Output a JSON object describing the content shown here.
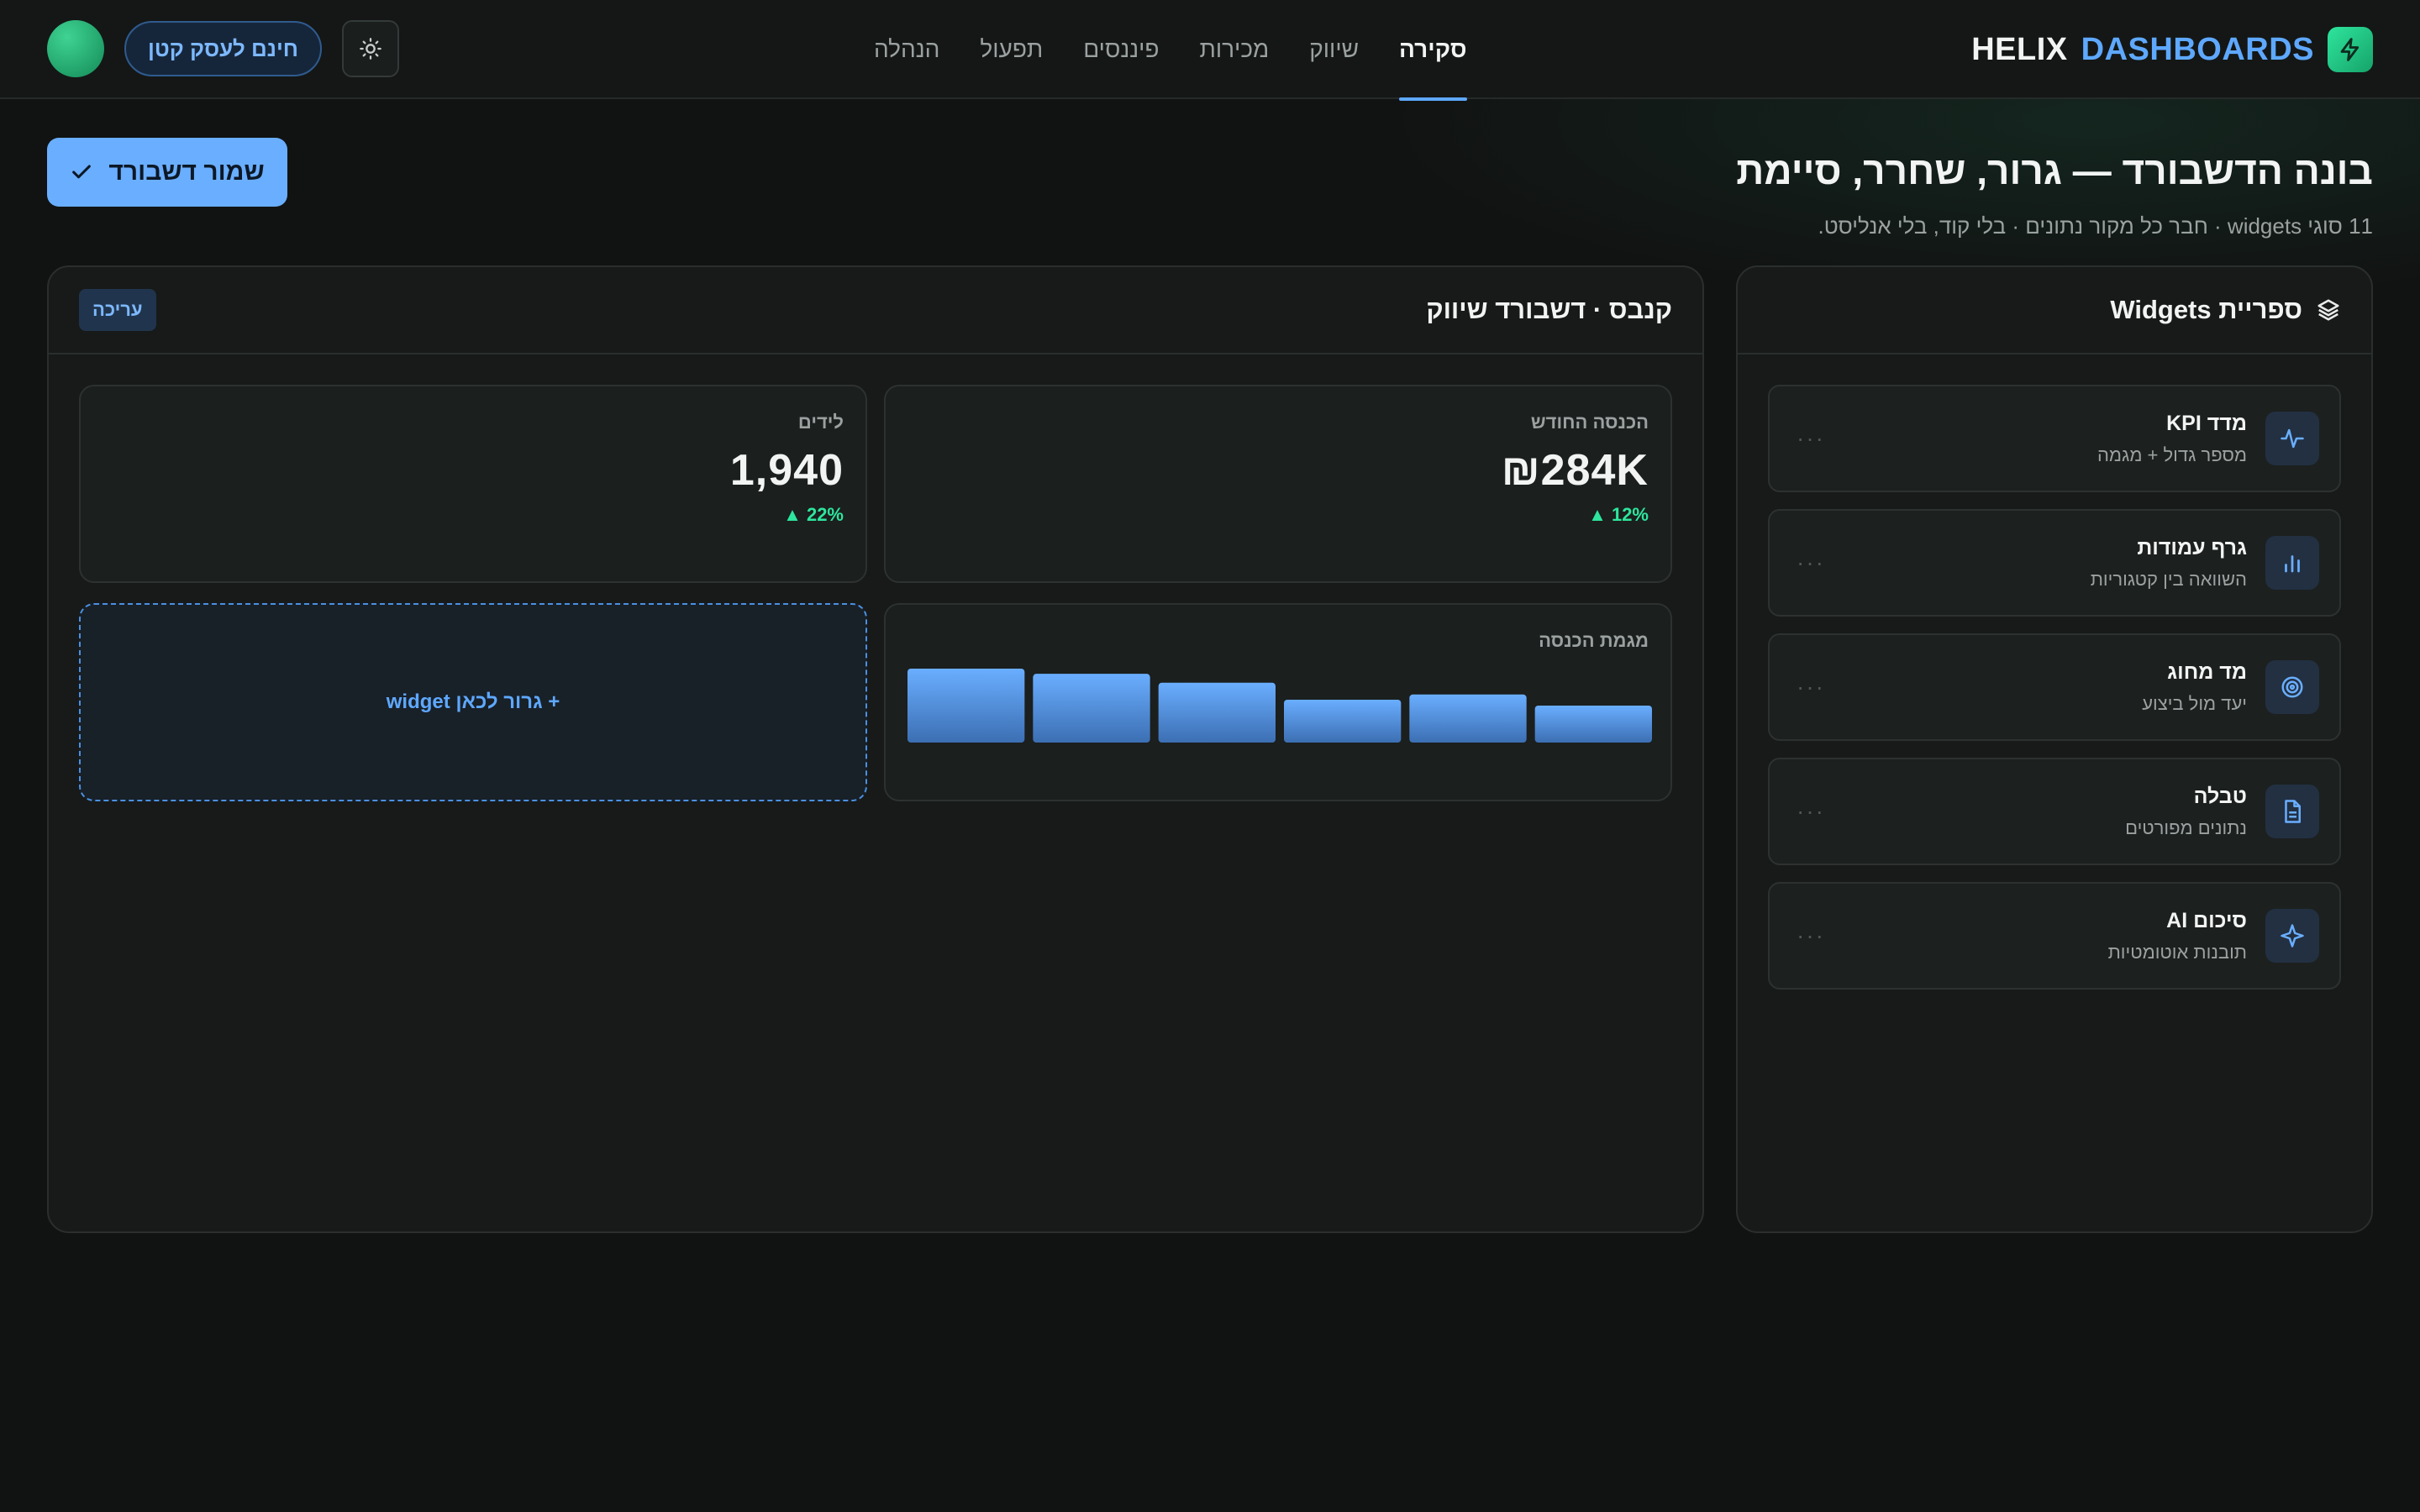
{
  "brand": {
    "name": "HELIX",
    "product": "DASHBOARDS"
  },
  "nav": [
    "סקירה",
    "שיווק",
    "מכירות",
    "פיננסים",
    "תפעול",
    "הנהלה"
  ],
  "top_actions": {
    "plan_label": "חינם לעסק קטן"
  },
  "header": {
    "title": "בונה הדשבורד — גרור, שחרר, סיימת",
    "subtitle": "11 סוגי widgets · חבר כל מקור נתונים · בלי קוד, בלי אנליסט.",
    "save_label": "שמור דשבורד"
  },
  "library": {
    "title": "ספריית Widgets",
    "items": [
      {
        "name": "מדד KPI",
        "desc": "מספר גדול + מגמה",
        "icon": "pulse-icon"
      },
      {
        "name": "גרף עמודות",
        "desc": "השוואה בין קטגוריות",
        "icon": "bar-chart-icon"
      },
      {
        "name": "מד מחוג",
        "desc": "יעד מול ביצוע",
        "icon": "target-icon"
      },
      {
        "name": "טבלה",
        "desc": "נתונים מפורטים",
        "icon": "document-icon"
      },
      {
        "name": "סיכום AI",
        "desc": "תובנות אוטומטיות",
        "icon": "sparkle-icon"
      }
    ],
    "more_glyph": "···"
  },
  "canvas": {
    "title": "קנבס · דשבורד שיווק",
    "edit_label": "עריכה",
    "kpis": [
      {
        "label": "הכנסה החודש",
        "value": "₪284K",
        "delta": "▲ 12%"
      },
      {
        "label": "לידים",
        "value": "1,940",
        "delta": "▲ 22%"
      }
    ],
    "trend_label": "מגמת הכנסה",
    "drop_label": "+ גרור לכאן widget"
  },
  "chart_data": {
    "type": "bar",
    "title": "מגמת הכנסה",
    "categories": [
      "",
      "",
      "",
      "",
      "",
      ""
    ],
    "values": [
      100,
      93,
      81,
      58,
      65,
      50
    ],
    "ylim": [
      0,
      100
    ]
  },
  "colors": {
    "accent": "#5ea8ff",
    "positive": "#2ee59d",
    "background": "#111312"
  }
}
